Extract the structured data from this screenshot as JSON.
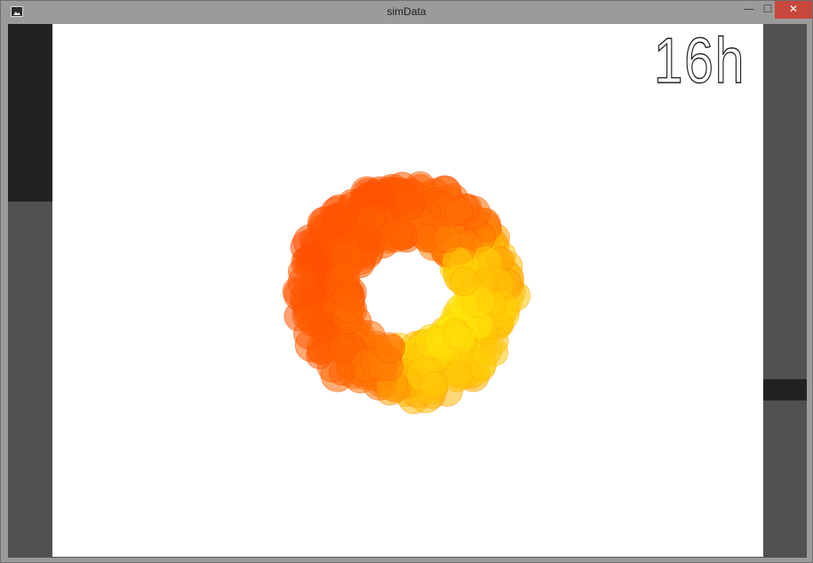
{
  "window": {
    "title": "simData",
    "buttons": {
      "minimize": "—",
      "maximize": "☐",
      "close": "✕"
    }
  },
  "sketch": {
    "time_label": "16h",
    "colors": {
      "background": "#ffffff",
      "outer": "#ff5a00",
      "inner": "#ffe600"
    }
  }
}
